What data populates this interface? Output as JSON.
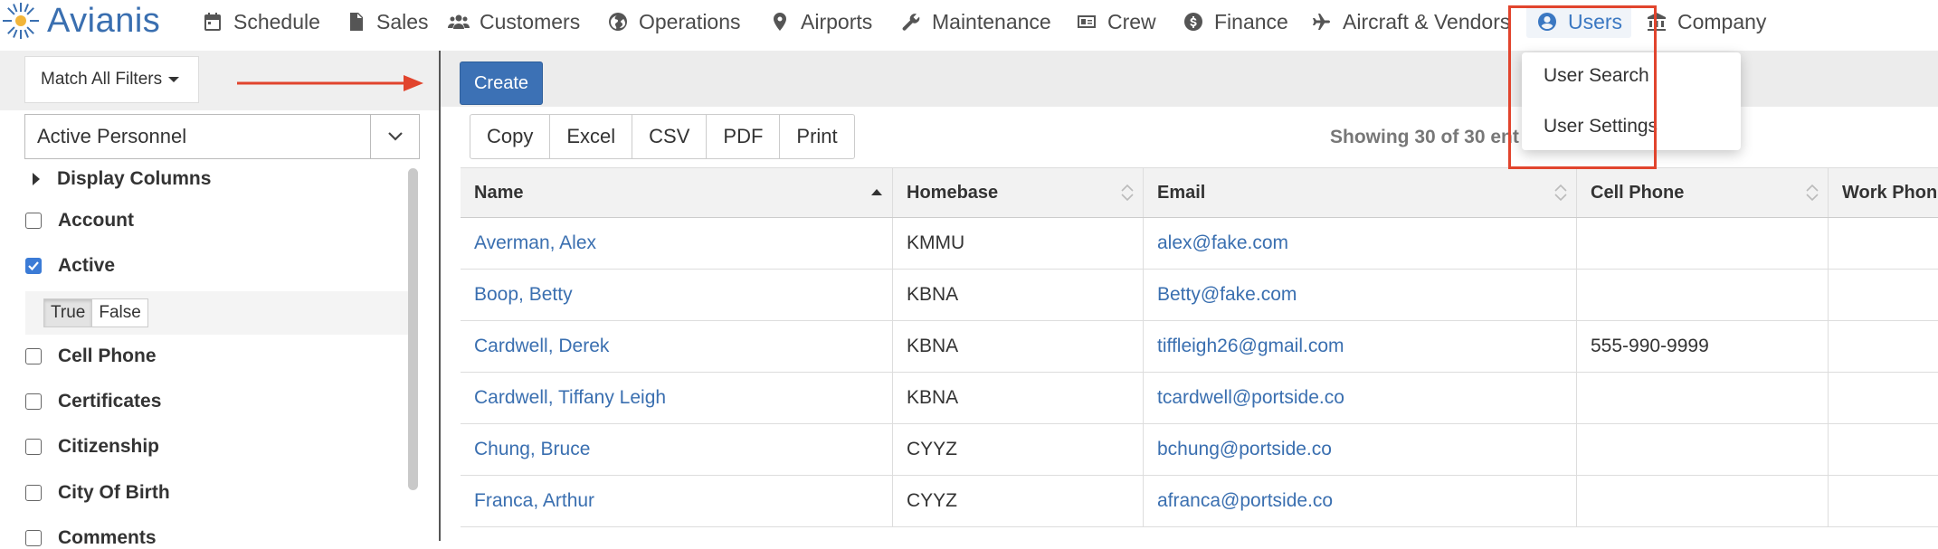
{
  "brand": {
    "name": "Avianis"
  },
  "nav": {
    "schedule": "Schedule",
    "sales": "Sales",
    "customers": "Customers",
    "operations": "Operations",
    "airports": "Airports",
    "maintenance": "Maintenance",
    "crew": "Crew",
    "finance": "Finance",
    "aircraft_vendors": "Aircraft & Vendors",
    "users": "Users",
    "company": "Company"
  },
  "users_menu": {
    "items": [
      "User Search",
      "User Settings"
    ]
  },
  "sidebar": {
    "match_label": "Match All Filters",
    "select_value": "Active Personnel",
    "display_columns": "Display Columns",
    "fields": {
      "account": {
        "label": "Account",
        "checked": false
      },
      "active": {
        "label": "Active",
        "checked": true
      },
      "cell_phone": {
        "label": "Cell Phone",
        "checked": false
      },
      "certificates": {
        "label": "Certificates",
        "checked": false
      },
      "citizenship": {
        "label": "Citizenship",
        "checked": false
      },
      "city_of_birth": {
        "label": "City Of Birth",
        "checked": false
      },
      "comments": {
        "label": "Comments",
        "checked": false
      }
    },
    "toggle": {
      "true_label": "True",
      "false_label": "False",
      "selected": "True"
    }
  },
  "toolbar": {
    "create": "Create",
    "export": [
      "Copy",
      "Excel",
      "CSV",
      "PDF",
      "Print"
    ],
    "showing": "Showing 30 of 30 ent"
  },
  "table": {
    "headers": [
      "Name",
      "Homebase",
      "Email",
      "Cell Phone",
      "Work Phon"
    ],
    "rows": [
      {
        "name": "Averman, Alex",
        "homebase": "KMMU",
        "email": "alex@fake.com",
        "cell": "",
        "work": ""
      },
      {
        "name": "Boop, Betty",
        "homebase": "KBNA",
        "email": "Betty@fake.com",
        "cell": "",
        "work": ""
      },
      {
        "name": "Cardwell, Derek",
        "homebase": "KBNA",
        "email": "tiffleigh26@gmail.com",
        "cell": "555-990-9999",
        "work": ""
      },
      {
        "name": "Cardwell, Tiffany Leigh",
        "homebase": "KBNA",
        "email": "tcardwell@portside.co",
        "cell": "",
        "work": ""
      },
      {
        "name": "Chung, Bruce",
        "homebase": "CYYZ",
        "email": "bchung@portside.co",
        "cell": "",
        "work": ""
      },
      {
        "name": "Franca, Arthur",
        "homebase": "CYYZ",
        "email": "afranca@portside.co",
        "cell": "",
        "work": ""
      }
    ]
  },
  "colors": {
    "accent": "#3a6fb0",
    "highlight": "#e1442d",
    "create_button": "#3c71b5"
  }
}
